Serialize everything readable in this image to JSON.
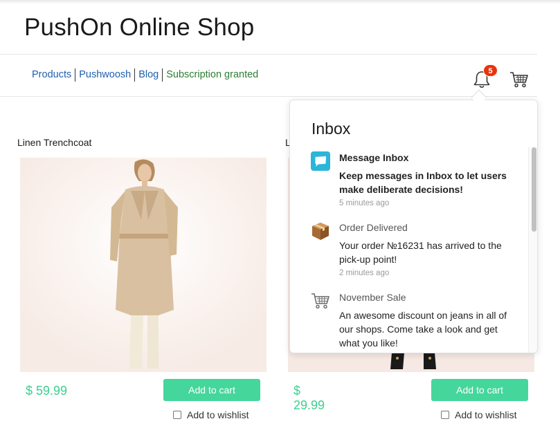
{
  "header": {
    "shop_title": "PushOn Online Shop"
  },
  "nav": {
    "links": [
      "Products",
      "Pushwoosh",
      "Blog"
    ],
    "status": "Subscription granted"
  },
  "notifications": {
    "badge_count": "5",
    "icon": "bell-icon",
    "cart_icon": "shopping-cart-icon"
  },
  "products": [
    {
      "name": "Linen Trenchcoat",
      "price": "$ 59.99",
      "add_label": "Add to cart",
      "wishlist_label": "Add to wishlist"
    },
    {
      "name": "L",
      "price": "$ 29.99",
      "add_label": "Add to cart",
      "wishlist_label": "Add to wishlist"
    }
  ],
  "inbox": {
    "title": "Inbox",
    "messages": [
      {
        "icon": "chat-bubble-icon",
        "title": "Message Inbox",
        "body": "Keep messages in Inbox to let users make deliberate decisions!",
        "time": "5 minutes ago",
        "unread": true
      },
      {
        "icon": "package-box-icon",
        "title": "Order Delivered",
        "body": "Your order №16231 has arrived to the pick-up point!",
        "time": "2 minutes ago",
        "unread": false
      },
      {
        "icon": "shopping-cart-icon",
        "title": "November Sale",
        "body": "An awesome discount on jeans in all of our shops. Come take a look and get what you like!",
        "time": "",
        "unread": false
      }
    ]
  },
  "colors": {
    "accent_green": "#45d69b",
    "price_green": "#3ccf8f",
    "link_blue": "#1f5fb0",
    "status_green": "#2e7d32",
    "badge_red": "#e8340c"
  }
}
